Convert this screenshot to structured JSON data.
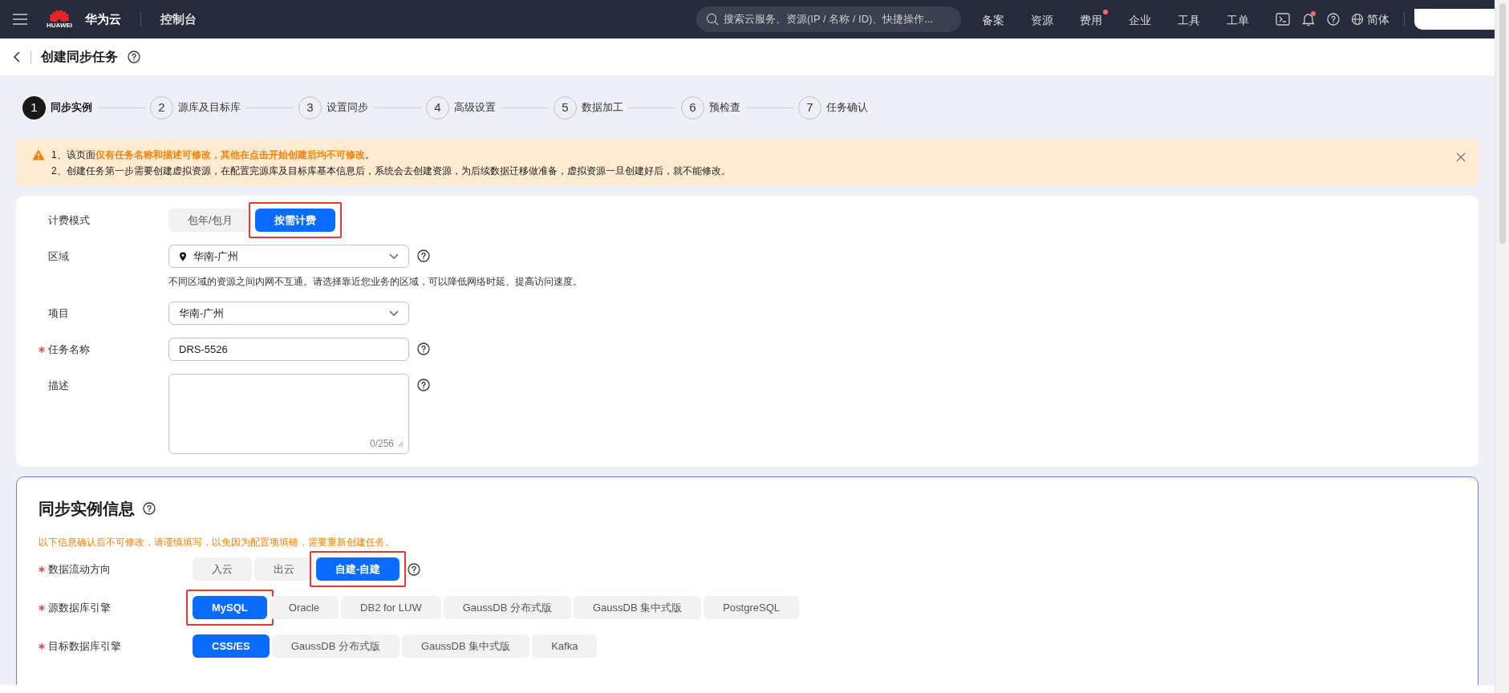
{
  "topbar": {
    "logo_text": "HUAWEI",
    "brand": "华为云",
    "console": "控制台",
    "search": {
      "placeholder": "搜索云服务、资源(IP / 名称 / ID)、快捷操作..."
    },
    "nav": [
      {
        "label": "备案",
        "badge": false
      },
      {
        "label": "资源",
        "badge": false
      },
      {
        "label": "费用",
        "badge": true
      },
      {
        "label": "企业",
        "badge": false
      },
      {
        "label": "工具",
        "badge": false
      },
      {
        "label": "工单",
        "badge": false
      }
    ],
    "icons": [
      {
        "kind": "terminal",
        "badge": false
      },
      {
        "kind": "bell",
        "badge": true
      },
      {
        "kind": "help",
        "badge": false
      }
    ],
    "language": "简体"
  },
  "page_header": {
    "title": "创建同步任务"
  },
  "steps": [
    {
      "number": "1",
      "label": "同步实例",
      "selected": true
    },
    {
      "number": "2",
      "label": "源库及目标库",
      "selected": false
    },
    {
      "number": "3",
      "label": "设置同步",
      "selected": false
    },
    {
      "number": "4",
      "label": "高级设置",
      "selected": false
    },
    {
      "number": "5",
      "label": "数据加工",
      "selected": false
    },
    {
      "number": "6",
      "label": "预检查",
      "selected": false
    },
    {
      "number": "7",
      "label": "任务确认",
      "selected": false
    }
  ],
  "alert": {
    "lines": [
      "1、该页面**仅有任务名称和描述可修改，其他在点击开始创建后均不可修改**。",
      "2、创建任务第一步需要创建虚拟资源，在配置完源库及目标库基本信息后，系统会去创建资源，为后续数据迁移做准备，虚拟资源一旦创建好后，就不能修改。"
    ]
  },
  "form": [
    {
      "kind": "segmented",
      "label": "计费模式",
      "required": false,
      "help": false,
      "options": [
        {
          "label": "包年/包月",
          "selected": false,
          "highlighted": false
        },
        {
          "label": "按需计费",
          "selected": true,
          "highlighted": true
        }
      ]
    },
    {
      "kind": "location_select",
      "label": "区域",
      "required": false,
      "help": true,
      "value": "华南-广州",
      "hint": "不同区域的资源之间内网不互通。请选择靠近您业务的区域，可以降低网络时延、提高访问速度。"
    },
    {
      "kind": "select",
      "label": "项目",
      "required": false,
      "help": false,
      "value": "华南-广州"
    },
    {
      "kind": "text",
      "label": "任务名称",
      "required": true,
      "help": true,
      "value": "DRS-5526"
    },
    {
      "kind": "textarea",
      "label": "描述",
      "required": false,
      "help": true,
      "counter": "0/256"
    }
  ],
  "section": {
    "title": "同步实例信息",
    "note": "以下信息确认后不可修改，请谨慎填写，以免因为配置项填错，需要重新创建任务。",
    "rows": [
      {
        "label": "数据流动方向",
        "required": true,
        "help": true,
        "options": [
          {
            "label": "入云",
            "selected": false,
            "highlighted": false
          },
          {
            "label": "出云",
            "selected": false,
            "highlighted": false
          },
          {
            "label": "自建-自建",
            "selected": true,
            "highlighted": true
          }
        ]
      },
      {
        "label": "源数据库引擎",
        "required": true,
        "help": false,
        "options": [
          {
            "label": "MySQL",
            "selected": true,
            "highlighted": true
          },
          {
            "label": "Oracle",
            "selected": false,
            "highlighted": false
          },
          {
            "label": "DB2 for LUW",
            "selected": false,
            "highlighted": false
          },
          {
            "label": "GaussDB 分布式版",
            "selected": false,
            "highlighted": false
          },
          {
            "label": "GaussDB 集中式版",
            "selected": false,
            "highlighted": false
          },
          {
            "label": "PostgreSQL",
            "selected": false,
            "highlighted": false
          }
        ]
      },
      {
        "label": "目标数据库引擎",
        "required": true,
        "help": false,
        "options": [
          {
            "label": "CSS/ES",
            "selected": true,
            "highlighted": false
          },
          {
            "label": "GaussDB 分布式版",
            "selected": false,
            "highlighted": false
          },
          {
            "label": "GaussDB 集中式版",
            "selected": false,
            "highlighted": false
          },
          {
            "label": "Kafka",
            "selected": false,
            "highlighted": false
          }
        ]
      }
    ]
  }
}
